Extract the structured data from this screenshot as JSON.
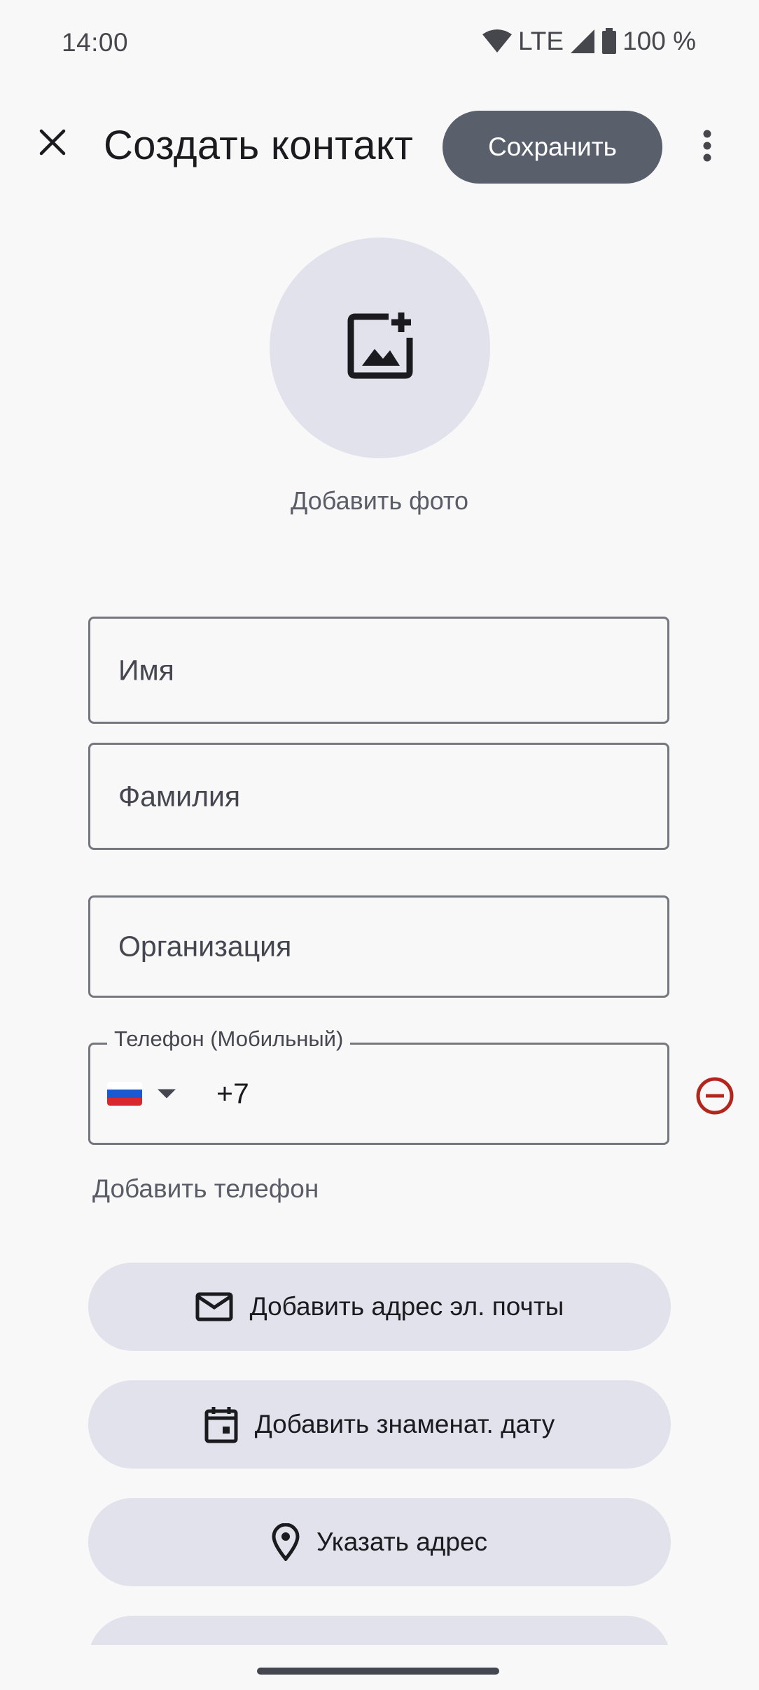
{
  "status_bar": {
    "time": "14:00",
    "network": "LTE",
    "battery": "100 %",
    "icons": [
      "wifi-icon",
      "cell-signal-icon",
      "battery-icon"
    ]
  },
  "app_bar": {
    "title": "Создать контакт",
    "save_label": "Сохранить",
    "icons": [
      "close-icon",
      "more-vert-icon"
    ]
  },
  "photo": {
    "label": "Добавить фото",
    "icon": "add-photo-icon"
  },
  "form": {
    "first_name_placeholder": "Имя",
    "last_name_placeholder": "Фамилия",
    "organization_placeholder": "Организация",
    "phone": {
      "label": "Телефон (Мобильный)",
      "country_flag": "Russia",
      "value": "+7",
      "remove_icon": "remove-circle-icon"
    },
    "add_phone_label": "Добавить телефон"
  },
  "actions": [
    {
      "label": "Добавить адрес эл. почты",
      "icon": "mail-icon"
    },
    {
      "label": "Добавить знаменат. дату",
      "icon": "calendar-icon"
    },
    {
      "label": "Указать адрес",
      "icon": "location-pin-icon"
    }
  ],
  "colors": {
    "background": "#f9f8f9",
    "save_button": "#595f6b",
    "pill_background": "#e1e2ec",
    "remove_icon": "#b3261e"
  }
}
